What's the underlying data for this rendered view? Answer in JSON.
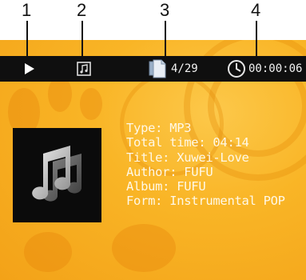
{
  "callouts": [
    "1",
    "2",
    "3",
    "4"
  ],
  "status_bar": {
    "play_state_icon": "play-icon",
    "mode_icon": "music-file-icon",
    "file_icon": "document-icon",
    "track_counter": "4/29",
    "clock_icon": "clock-icon",
    "elapsed_time": "00:00:06"
  },
  "track_info": {
    "type": "Type: MP3",
    "total_time": "Total time: 04:14",
    "title": "Title: Xuwei-Love",
    "author": "Author: FUFU",
    "album": "Album: FUFU",
    "form": "Form: Instrumental POP"
  },
  "colors": {
    "background": "#f9b526",
    "status_bar": "#0f0f0f",
    "text": "#fff8e6"
  }
}
